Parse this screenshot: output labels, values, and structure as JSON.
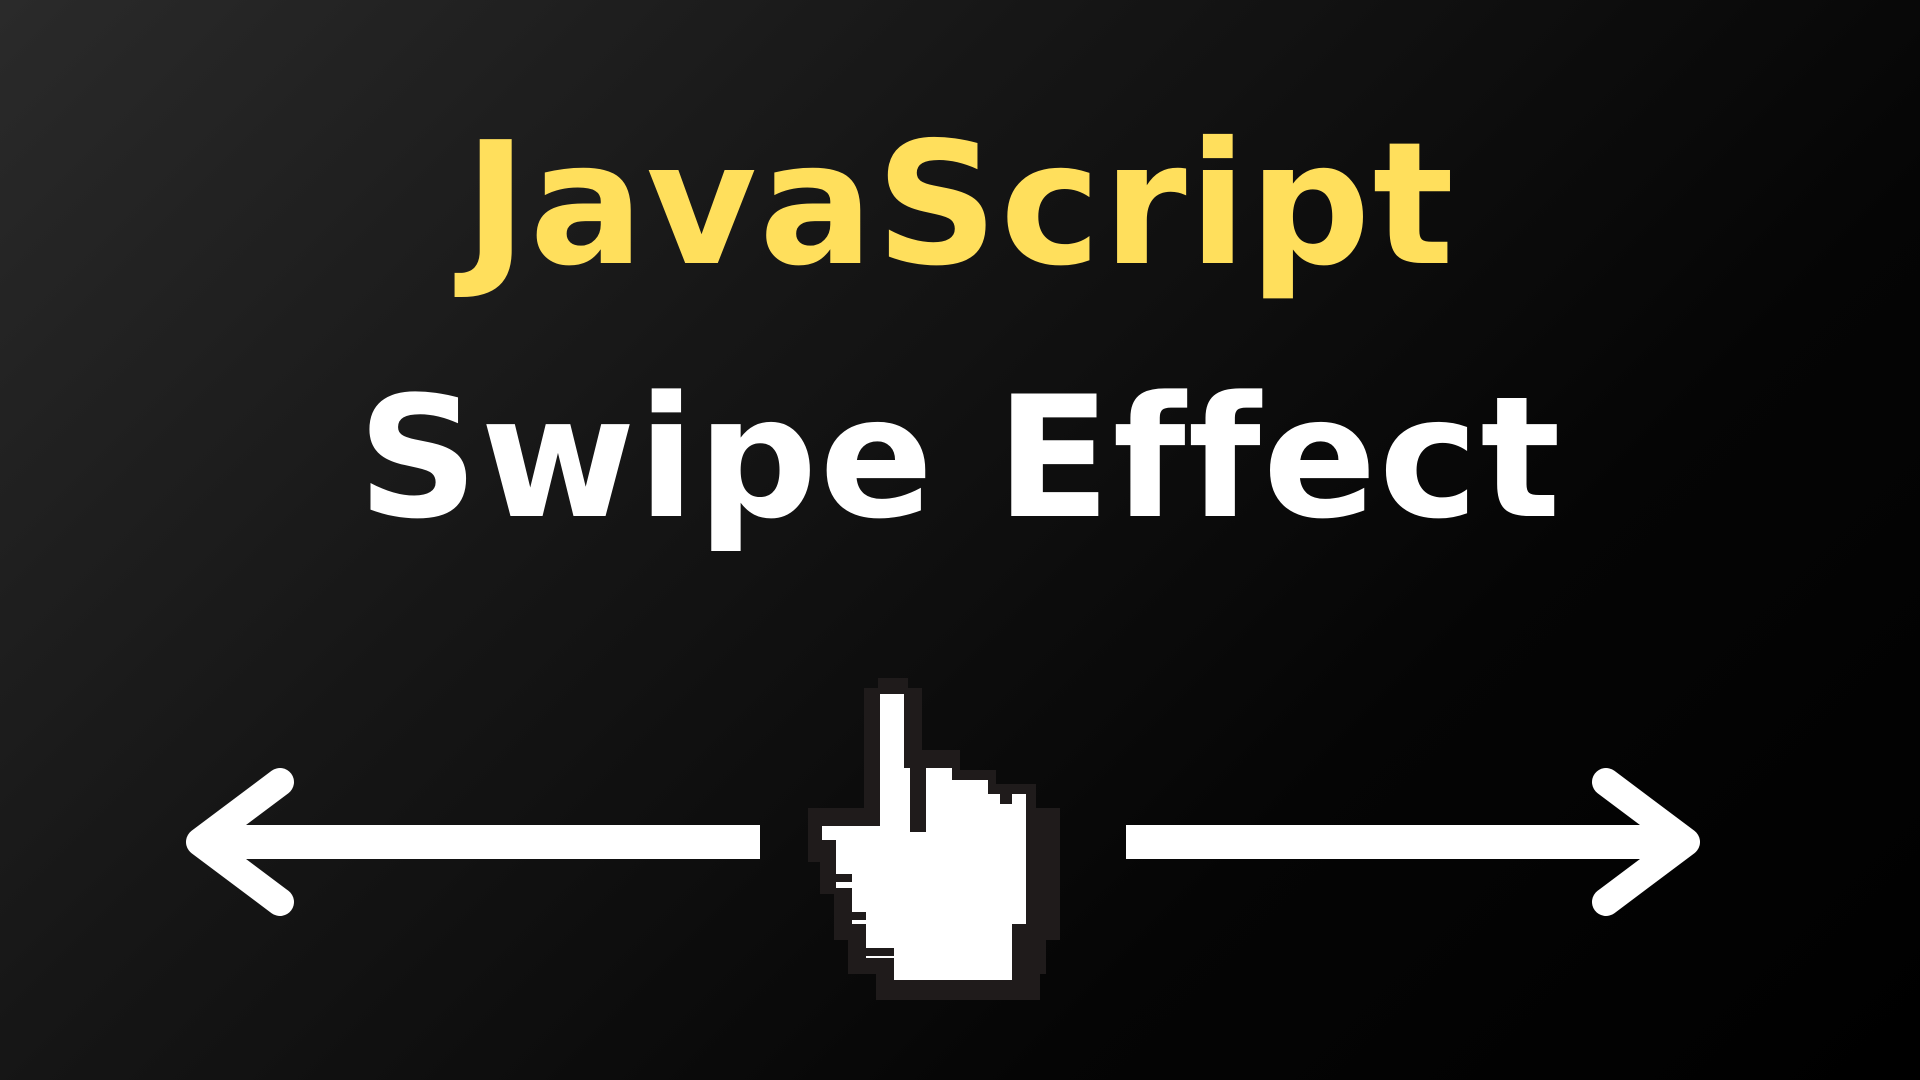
{
  "title": {
    "line1": "JavaScript",
    "line2": "Swipe Effect"
  },
  "icons": {
    "left": "arrow-left-icon",
    "right": "arrow-right-icon",
    "cursor": "hand-pointer-cursor-icon"
  },
  "colors": {
    "accent_yellow": "#FFDF5C",
    "text_white": "#FFFFFF",
    "cursor_outline": "#1F1B1B",
    "background_dark": "#000000",
    "background_light": "#2A2A2A"
  }
}
